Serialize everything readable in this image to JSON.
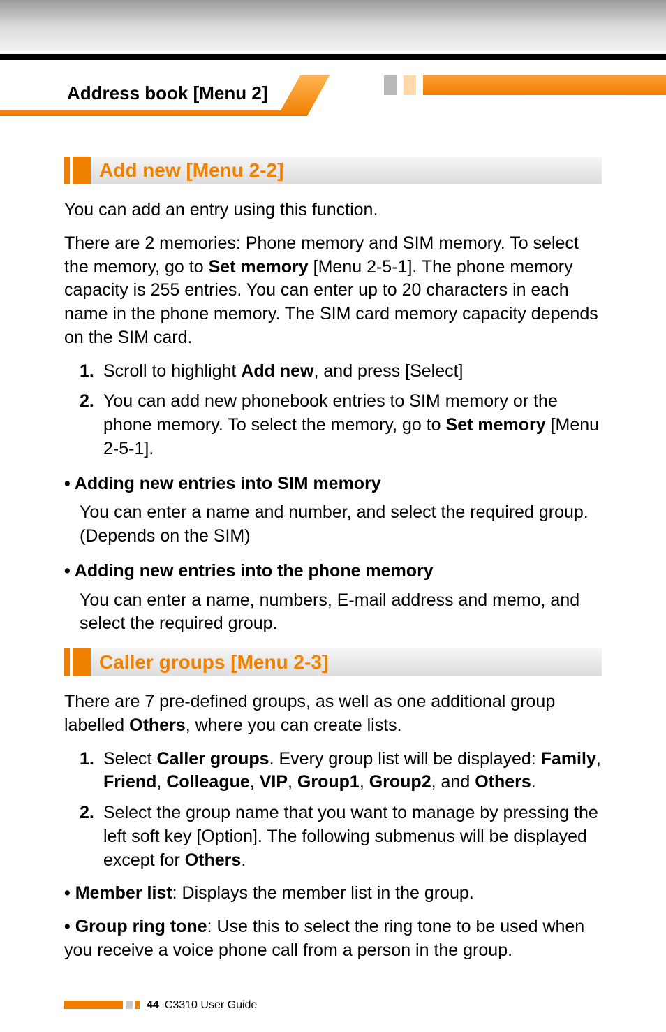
{
  "header": {
    "title": "Address book [Menu 2]"
  },
  "sections": {
    "addnew": {
      "heading": "Add new [Menu 2-2]",
      "intro": "You can add an entry using this function.",
      "body_pre": "There are 2 memories: Phone memory and SIM memory. To select the memory, go to ",
      "body_bold": "Set memory",
      "body_post": " [Menu 2-5-1]. The phone memory capacity is 255 entries. You can enter up to 20 characters in each name in the phone memory. The SIM card memory capacity depends on the SIM card.",
      "steps": [
        {
          "num": "1.",
          "pre": "Scroll to highlight ",
          "bold": "Add new",
          "post": ", and press [Select]"
        },
        {
          "num": "2.",
          "pre": "You can add new phonebook entries to SIM memory or the phone memory. To select the memory, go to ",
          "bold": "Set memory",
          "post": " [Menu 2-5-1]."
        }
      ],
      "bullets": [
        {
          "head": "• Adding new entries into SIM memory",
          "body": "You can enter a name and number, and select the required group. (Depends on the SIM)"
        },
        {
          "head": "• Adding new entries into the phone memory",
          "body": "You can enter a name, numbers, E-mail address and memo, and select the required group."
        }
      ]
    },
    "callergroups": {
      "heading": "Caller groups [Menu 2-3]",
      "intro_pre": "There are 7 pre-defined groups, as well as one additional group labelled ",
      "intro_bold": "Others",
      "intro_post": ", where you can create lists.",
      "step1": {
        "num": "1.",
        "s1": "Select ",
        "b1": "Caller groups",
        "s2": ". Every group list will be displayed: ",
        "g1": "Family",
        "c1": ", ",
        "g2": "Friend",
        "c2": ", ",
        "g3": "Colleague",
        "c3": ", ",
        "g4": "VIP",
        "c4": ", ",
        "g5": "Group1",
        "c5": ", ",
        "g6": "Group2",
        "s3": ", and ",
        "g7": "Others",
        "s4": "."
      },
      "step2": {
        "num": "2.",
        "pre": "Select the group name that you want to manage by pressing the left soft key [Option]. The following submenus will be displayed except for ",
        "bold": "Others",
        "post": "."
      },
      "bullets": [
        {
          "lead": "• Member list",
          "rest": ": Displays the member list in the group."
        },
        {
          "lead": "• Group ring tone",
          "rest": ": Use this to select the ring tone to be used when you receive a voice phone call from a person in the group."
        }
      ]
    }
  },
  "footer": {
    "page": "44",
    "guide": "C3310 User Guide"
  }
}
